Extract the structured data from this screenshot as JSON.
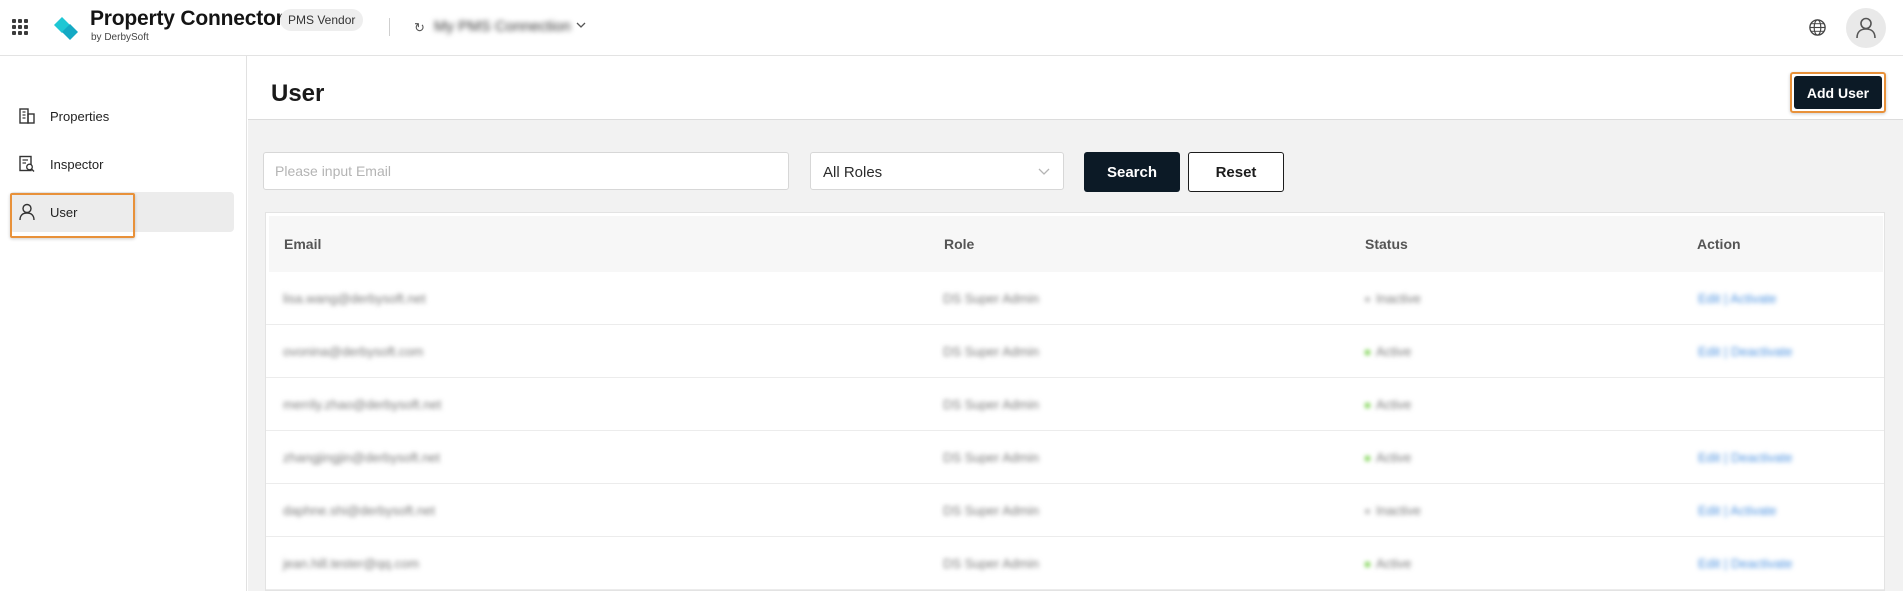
{
  "header": {
    "app_title": "Property Connector",
    "app_subtitle": "by DerbySoft",
    "vendor_badge": "PMS Vendor",
    "connection_name": "My PMS Connection"
  },
  "sidebar": {
    "items": [
      {
        "label": "Properties",
        "icon": "building-icon"
      },
      {
        "label": "Inspector",
        "icon": "inspector-icon"
      },
      {
        "label": "User",
        "icon": "user-icon",
        "active": true
      }
    ]
  },
  "page": {
    "title": "User",
    "add_user_label": "Add User"
  },
  "filters": {
    "email_placeholder": "Please input Email",
    "email_value": "",
    "roles_value": "All Roles",
    "search_label": "Search",
    "reset_label": "Reset"
  },
  "table": {
    "columns": [
      "Email",
      "Role",
      "Status",
      "Action"
    ],
    "rows": [
      {
        "email": "lisa.wang@derbysoft.net",
        "role": "DS Super Admin",
        "status": "Inactive",
        "status_color": "#b0b0b0",
        "action": "Edit | Activate"
      },
      {
        "email": "ovonina@derbysoft.com",
        "role": "DS Super Admin",
        "status": "Active",
        "status_color": "#52c41a",
        "action": "Edit | Deactivate"
      },
      {
        "email": "merrily.zhao@derbysoft.net",
        "role": "DS Super Admin",
        "status": "Active",
        "status_color": "#52c41a",
        "action": ""
      },
      {
        "email": "zhangjingjin@derbysoft.net",
        "role": "DS Super Admin",
        "status": "Active",
        "status_color": "#52c41a",
        "action": "Edit | Deactivate"
      },
      {
        "email": "daphne.shi@derbysoft.net",
        "role": "DS Super Admin",
        "status": "Inactive",
        "status_color": "#b0b0b0",
        "action": "Edit | Activate"
      },
      {
        "email": "jean.hill.tester@qq.com",
        "role": "DS Super Admin",
        "status": "Active",
        "status_color": "#52c41a",
        "action": "Edit | Deactivate"
      }
    ]
  },
  "colors": {
    "primary_button": "#0c1a26",
    "highlight": "#e8913a",
    "logo": "#1fc7d4",
    "link": "#4e93e0"
  }
}
